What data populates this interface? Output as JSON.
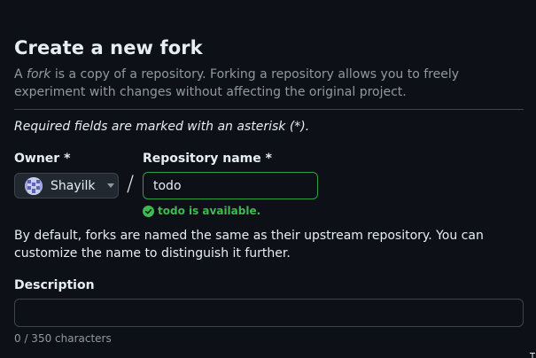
{
  "page": {
    "title": "Create a new fork",
    "intro": {
      "prefix": "A ",
      "emphasis": "fork",
      "suffix": " is a copy of a repository. Forking a repository allows you to freely experiment with changes without affecting the original project."
    },
    "required_note": "Required fields are marked with an asterisk (*)."
  },
  "owner": {
    "label": "Owner *",
    "selected": "Shayilk",
    "avatar_icon": "identicon-avatar",
    "dropdown_icon": "triangle-down-icon"
  },
  "separator": "/",
  "repository": {
    "label": "Repository name *",
    "value": "todo",
    "availability": "todo is available.",
    "availability_icon": "check-circle-icon"
  },
  "default_note": "By default, forks are named the same as their upstream repository. You can customize the name to distinguish it further.",
  "description": {
    "label": "Description",
    "value": "",
    "char_count": "0 / 350 characters"
  },
  "colors": {
    "background": "#0d1117",
    "text": "#e6edf3",
    "muted": "#9198a1",
    "border": "#3d444d",
    "success": "#3fb950",
    "success_border": "#2ea043"
  }
}
